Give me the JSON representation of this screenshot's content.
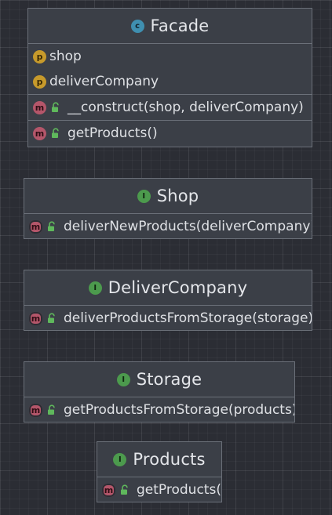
{
  "nodes": [
    {
      "id": "facade",
      "kind": "class",
      "kind_letter": "c",
      "title": "Facade",
      "fields": [
        {
          "badge": "p",
          "text": "shop"
        },
        {
          "badge": "p",
          "text": "deliverCompany"
        }
      ],
      "methods": [
        {
          "badge": "m",
          "text": "__construct(shop, deliverCompany)"
        },
        {
          "badge": "m",
          "text": "getProducts()"
        }
      ]
    },
    {
      "id": "shop",
      "kind": "interface",
      "kind_letter": "I",
      "title": "Shop",
      "methods": [
        {
          "badge": "m",
          "text": "deliverNewProducts(deliverCompany)"
        }
      ]
    },
    {
      "id": "deliver-company",
      "kind": "interface",
      "kind_letter": "I",
      "title": "DeliverCompany",
      "methods": [
        {
          "badge": "m",
          "text": "deliverProductsFromStorage(storage)"
        }
      ]
    },
    {
      "id": "storage",
      "kind": "interface",
      "kind_letter": "I",
      "title": "Storage",
      "methods": [
        {
          "badge": "m",
          "text": "getProductsFromStorage(products)"
        }
      ]
    },
    {
      "id": "products",
      "kind": "interface",
      "kind_letter": "I",
      "title": "Products",
      "methods": [
        {
          "badge": "m",
          "text": "getProducts()"
        }
      ]
    }
  ],
  "colors": {
    "background": "#2b2d34",
    "node_fill": "#3b3f47",
    "node_border": "#6b7079",
    "class_badge": "#3f8fb0",
    "interface_badge": "#4c9a4d",
    "property_badge": "#c79a2b",
    "method_badge": "#b4566a",
    "public_lock": "#5fb85c"
  }
}
